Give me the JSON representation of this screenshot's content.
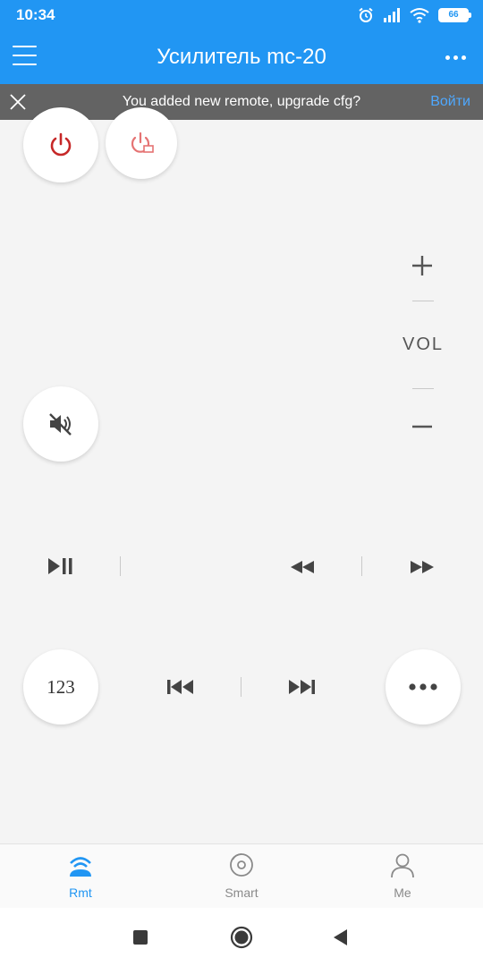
{
  "status_bar": {
    "time": "10:34",
    "battery": "66"
  },
  "app_bar": {
    "title": "Усилитель mc-20"
  },
  "banner": {
    "message": "You added new remote, upgrade cfg?",
    "action": "Войти"
  },
  "remote": {
    "volume_label": "VOL",
    "number_button": "123"
  },
  "bottom_nav": [
    {
      "label": "Rmt",
      "icon": "remote-icon",
      "active": true
    },
    {
      "label": "Smart",
      "icon": "smart-icon",
      "active": false
    },
    {
      "label": "Me",
      "icon": "person-icon",
      "active": false
    }
  ],
  "colors": {
    "accent": "#2196f3",
    "power_red": "#c62828",
    "tv_power_pink": "#e57373",
    "banner_bg": "#636363",
    "banner_link": "#4ea8ff"
  }
}
